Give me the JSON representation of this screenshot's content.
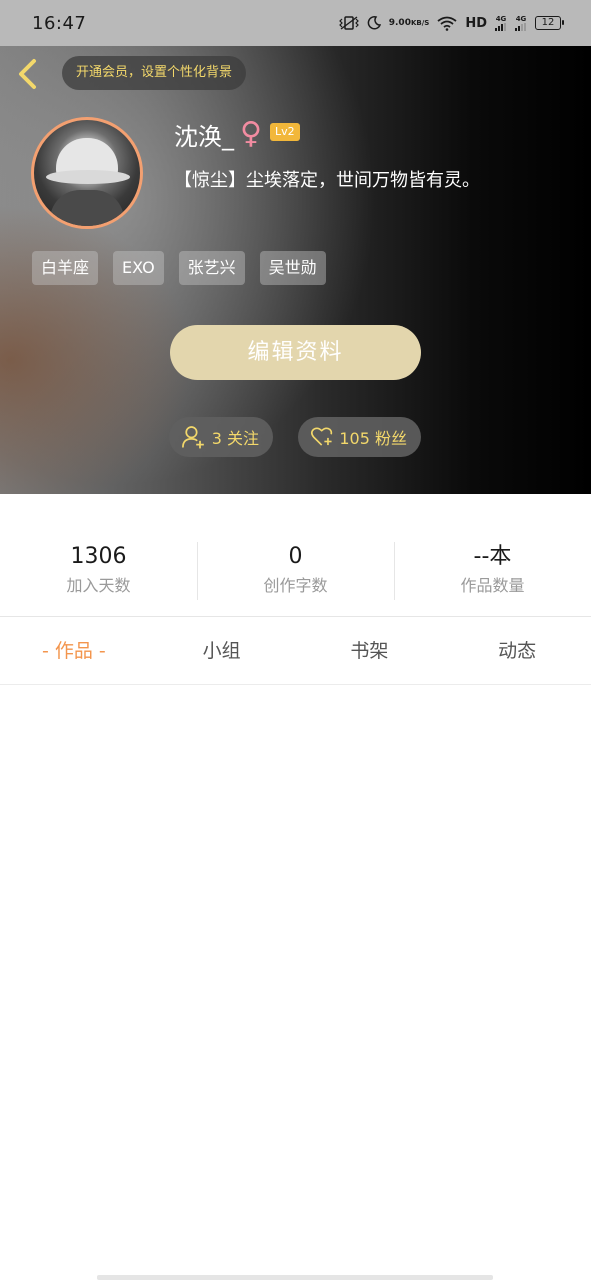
{
  "status_bar": {
    "time": "16:47",
    "net_speed_value": "9.00",
    "net_speed_unit": "KB/S",
    "hd_label": "HD",
    "signal_1": "4G",
    "signal_2": "4G",
    "battery": "12"
  },
  "header": {
    "vip_prompt": "开通会员，设置个性化背景"
  },
  "profile": {
    "nickname": "沈涣_",
    "gender_symbol": "♀",
    "level": "Lv2",
    "signature": "【惊尘】尘埃落定，世间万物皆有灵。",
    "tags": [
      "白羊座",
      "EXO",
      "张艺兴",
      "吴世勋"
    ],
    "edit_label": "编辑资料",
    "follow_label": "3 关注",
    "fans_label": "105 粉丝"
  },
  "stats": [
    {
      "value": "1306",
      "label": "加入天数"
    },
    {
      "value": "0",
      "label": "创作字数"
    },
    {
      "value": "--本",
      "label": "作品数量"
    }
  ],
  "tabs": [
    "- 作品 -",
    "小组",
    "书架",
    "动态"
  ],
  "colors": {
    "accent_gold": "#f3d86b",
    "edit_button": "#e3d6ad",
    "active_tab": "#f3954d",
    "level_badge": "#f2b73a",
    "female": "#f28ca1"
  }
}
